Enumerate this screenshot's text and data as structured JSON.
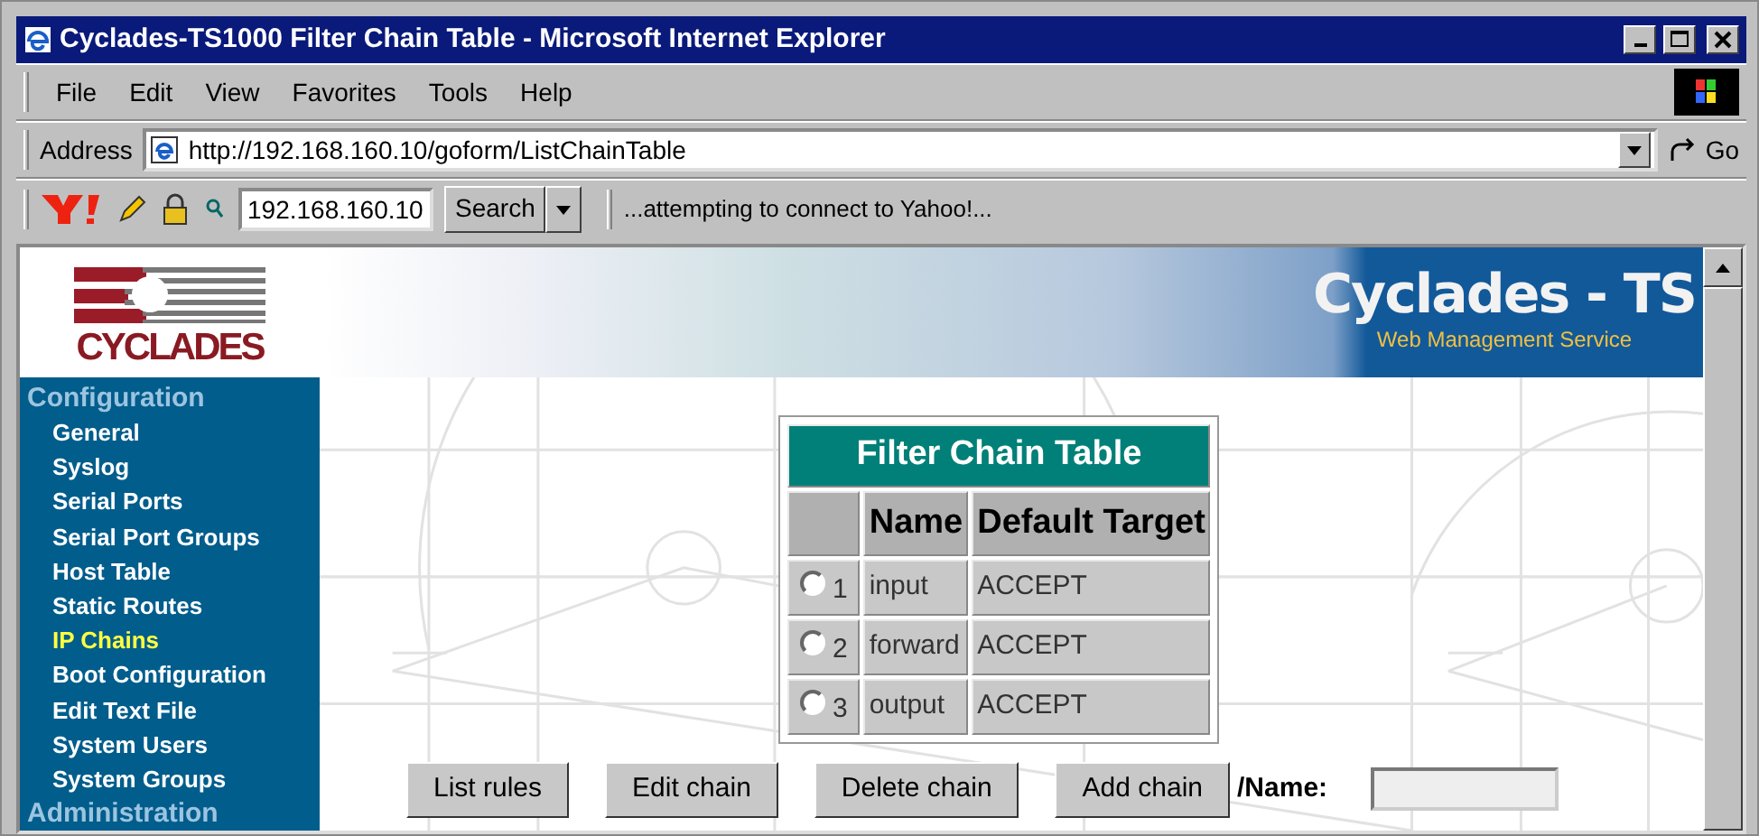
{
  "window": {
    "title": "Cyclades-TS1000 Filter Chain Table - Microsoft Internet Explorer"
  },
  "menu": [
    "File",
    "Edit",
    "View",
    "Favorites",
    "Tools",
    "Help"
  ],
  "address_bar": {
    "label": "Address",
    "url": "http://192.168.160.10/goform/ListChainTable",
    "go": "Go"
  },
  "toolbar": {
    "search_value": "192.168.160.10",
    "search_button": "Search",
    "status": "...attempting to connect to Yahoo!..."
  },
  "header": {
    "logo": "CYCLADES",
    "title": "Cyclades - TS",
    "subtitle": "Web Management Service"
  },
  "sidebar": {
    "sections": [
      {
        "title": "Configuration",
        "items": [
          {
            "label": "General",
            "selected": false
          },
          {
            "label": "Syslog",
            "selected": false
          },
          {
            "label": "Serial Ports",
            "selected": false
          },
          {
            "label": "Serial Port Groups",
            "selected": false
          },
          {
            "label": "Host Table",
            "selected": false
          },
          {
            "label": "Static Routes",
            "selected": false
          },
          {
            "label": "IP Chains",
            "selected": true
          },
          {
            "label": "Boot Configuration",
            "selected": false
          },
          {
            "label": "Edit Text File",
            "selected": false
          },
          {
            "label": "System Users",
            "selected": false
          },
          {
            "label": "System Groups",
            "selected": false
          }
        ]
      },
      {
        "title": "Administration"
      }
    ]
  },
  "table": {
    "title": "Filter Chain Table",
    "columns": [
      "Name",
      "Default Target"
    ],
    "rows": [
      {
        "index": "1",
        "name": "input",
        "target": "ACCEPT",
        "selected": false
      },
      {
        "index": "2",
        "name": "forward",
        "target": "ACCEPT",
        "selected": false
      },
      {
        "index": "3",
        "name": "output",
        "target": "ACCEPT",
        "selected": false
      }
    ]
  },
  "buttons": [
    "List rules",
    "Edit chain",
    "Delete chain",
    "Add chain"
  ],
  "name_field": {
    "label": "/Name:"
  }
}
